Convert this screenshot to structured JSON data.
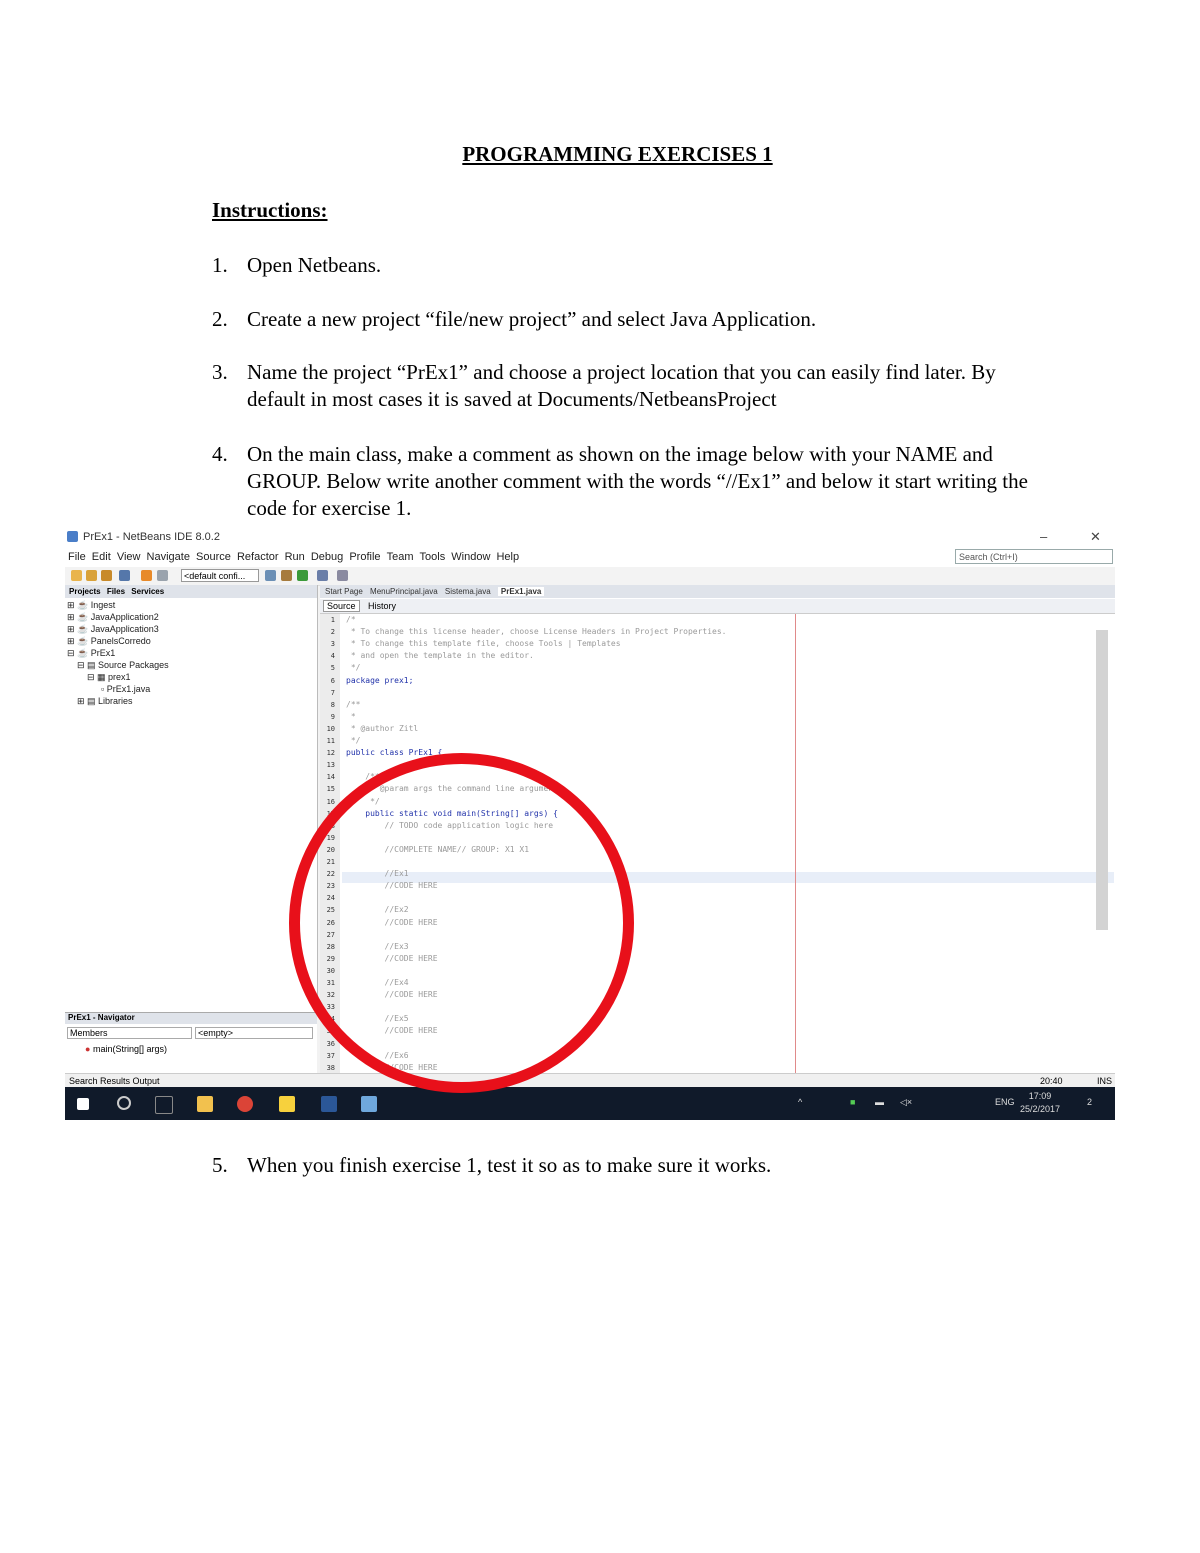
{
  "document": {
    "title": "PROGRAMMING EXERCISES 1",
    "instructions_heading": "Instructions:",
    "items": [
      {
        "num": "1.",
        "text": "Open Netbeans."
      },
      {
        "num": "2.",
        "text": "Create a new project “file/new project” and select Java Application."
      },
      {
        "num": "3.",
        "text": "Name the project “PrEx1” and choose a project location that you can easily find later. By default in most cases it is saved at Documents/NetbeansProject"
      },
      {
        "num": "4.",
        "text": "On the main class, make a comment as shown on the image below with your NAME and GROUP. Below write another comment with the words “//Ex1” and below it start writing the code for exercise 1."
      },
      {
        "num": "5.",
        "text": "When you finish exercise 1, test it so as to make sure it works."
      }
    ]
  },
  "screenshot": {
    "window_title": "PrEx1 - NetBeans IDE 8.0.2",
    "menu": [
      "File",
      "Edit",
      "View",
      "Navigate",
      "Source",
      "Refactor",
      "Run",
      "Debug",
      "Profile",
      "Team",
      "Tools",
      "Window",
      "Help"
    ],
    "search_placeholder": "Search (Ctrl+I)",
    "config": "<default confi...",
    "left_tabs": [
      "Projects",
      "Files",
      "Services"
    ],
    "tree": [
      "Ingest",
      "JavaApplication2",
      "JavaApplication3",
      "PanelsCorredo",
      "PrEx1",
      "Source Packages",
      "prex1",
      "PrEx1.java",
      "Libraries"
    ],
    "navigator": {
      "header": "PrEx1 - Navigator",
      "members": "Members",
      "filter": "<empty>",
      "item": "main(String[] args)"
    },
    "editor_tabs": [
      "Start Page",
      "MenuPrincipal.java",
      "Sistema.java",
      "PrEx1.java"
    ],
    "editor_tools": [
      "Source",
      "History"
    ],
    "code_lines": [
      {
        "n": "1",
        "t": "/*"
      },
      {
        "n": "2",
        "t": " * To change this license header, choose License Headers in Project Properties."
      },
      {
        "n": "3",
        "t": " * To change this template file, choose Tools | Templates"
      },
      {
        "n": "4",
        "t": " * and open the template in the editor."
      },
      {
        "n": "5",
        "t": " */"
      },
      {
        "n": "6",
        "t": "package prex1;"
      },
      {
        "n": "7",
        "t": ""
      },
      {
        "n": "8",
        "t": "/**"
      },
      {
        "n": "9",
        "t": " *"
      },
      {
        "n": "10",
        "t": " * @author Zitl"
      },
      {
        "n": "11",
        "t": " */"
      },
      {
        "n": "12",
        "t": "public class PrEx1 {"
      },
      {
        "n": "13",
        "t": ""
      },
      {
        "n": "14",
        "t": "    /**"
      },
      {
        "n": "15",
        "t": "     * @param args the command line arguments"
      },
      {
        "n": "16",
        "t": "     */"
      },
      {
        "n": "17",
        "t": "    public static void main(String[] args) {"
      },
      {
        "n": "18",
        "t": "        // TODO code application logic here"
      },
      {
        "n": "19",
        "t": ""
      },
      {
        "n": "20",
        "t": "        //COMPLETE NAME// GROUP: X1 X1"
      },
      {
        "n": "21",
        "t": ""
      },
      {
        "n": "22",
        "t": "        //Ex1"
      },
      {
        "n": "23",
        "t": "        //CODE HERE"
      },
      {
        "n": "24",
        "t": ""
      },
      {
        "n": "25",
        "t": "        //Ex2"
      },
      {
        "n": "26",
        "t": "        //CODE HERE"
      },
      {
        "n": "27",
        "t": ""
      },
      {
        "n": "28",
        "t": "        //Ex3"
      },
      {
        "n": "29",
        "t": "        //CODE HERE"
      },
      {
        "n": "30",
        "t": ""
      },
      {
        "n": "31",
        "t": "        //Ex4"
      },
      {
        "n": "32",
        "t": "        //CODE HERE"
      },
      {
        "n": "33",
        "t": ""
      },
      {
        "n": "34",
        "t": "        //Ex5"
      },
      {
        "n": "35",
        "t": "        //CODE HERE"
      },
      {
        "n": "36",
        "t": ""
      },
      {
        "n": "37",
        "t": "        //Ex6"
      },
      {
        "n": "38",
        "t": "        //CODE HERE"
      }
    ],
    "status": {
      "left": "Search Results   Output",
      "position": "20:40",
      "mode": "INS"
    },
    "taskbar": {
      "lang": "ENG",
      "time": "17:09",
      "date": "25/2/2017",
      "badge": "2"
    }
  }
}
